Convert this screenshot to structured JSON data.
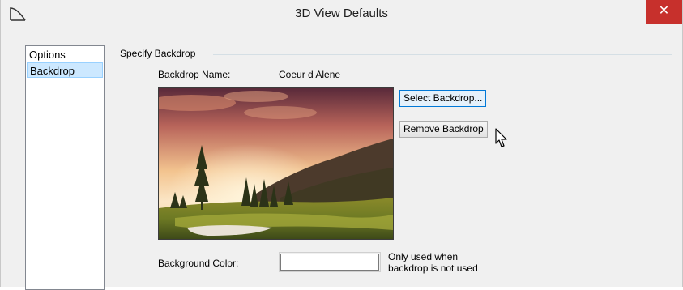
{
  "window": {
    "title": "3D View Defaults",
    "close_glyph": "✕"
  },
  "nav": {
    "items": [
      {
        "label": "Options",
        "selected": false
      },
      {
        "label": "Backdrop",
        "selected": true
      }
    ]
  },
  "backdrop": {
    "group_label": "Specify Backdrop",
    "name_label": "Backdrop Name:",
    "name_value": "Coeur d Alene",
    "select_button": "Select Backdrop...",
    "remove_button": "Remove Backdrop",
    "background_color_label": "Background Color:",
    "background_color_value": "#ffffff",
    "note_line1": "Only used when",
    "note_line2": "backdrop is not used"
  },
  "colors": {
    "close_button": "#c7302c",
    "selection": "#cce8ff",
    "hover_button": "#0078d7"
  },
  "icons": {
    "app": "chief-architect-logo-icon",
    "cursor": "mouse-pointer-icon"
  }
}
